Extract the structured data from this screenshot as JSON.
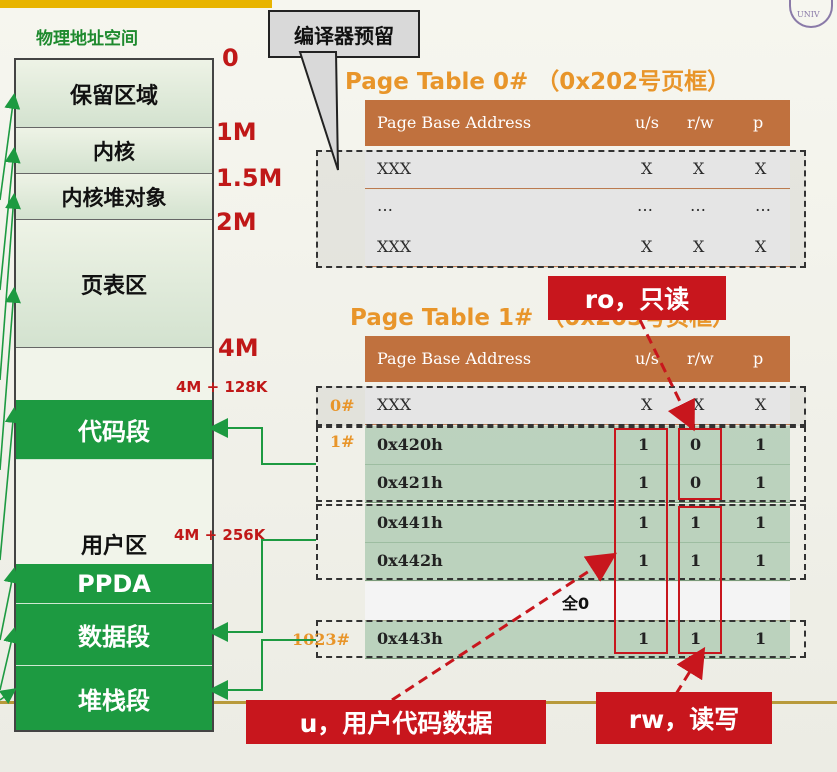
{
  "memory": {
    "title": "物理地址空间",
    "blocks": [
      "保留区域",
      "内核",
      "内核堆对象",
      "页表区",
      "代码段",
      "用户区",
      "PPDA",
      "数据段",
      "堆栈段"
    ],
    "addresses": [
      "0",
      "1M",
      "1.5M",
      "2M",
      "4M",
      "4M + 128K",
      "4M + 256K"
    ]
  },
  "callout": "编译器预留",
  "page_table_0": {
    "title": "Page Table 0#  （0x202号页框）",
    "headers": [
      "Page Base Address",
      "u/s",
      "r/w",
      "p"
    ],
    "rows": [
      [
        "XXX",
        "X",
        "X",
        "X"
      ],
      [
        "…",
        "…",
        "…",
        "…"
      ],
      [
        "XXX",
        "X",
        "X",
        "X"
      ]
    ]
  },
  "page_table_1": {
    "title": "Page Table 1#  （0x203号页框）",
    "headers": [
      "Page Base Address",
      "u/s",
      "r/w",
      "p"
    ],
    "index_labels": [
      "0#",
      "1#",
      "1023#"
    ],
    "rows": [
      [
        "XXX",
        "X",
        "X",
        "X"
      ],
      [
        "0x420h",
        "1",
        "0",
        "1"
      ],
      [
        "0x421h",
        "1",
        "0",
        "1"
      ],
      [
        "0x441h",
        "1",
        "1",
        "1"
      ],
      [
        "0x442h",
        "1",
        "1",
        "1"
      ],
      [
        "0x443h",
        "1",
        "1",
        "1"
      ]
    ],
    "zero_note": "全0"
  },
  "annotations": {
    "ro": "ro，只读",
    "u": "u，用户代码数据",
    "rw": "rw，读写"
  },
  "colors": {
    "green": "#1d9a41",
    "red": "#c8161d",
    "orange": "#e8952a",
    "header": "#c0713e"
  }
}
